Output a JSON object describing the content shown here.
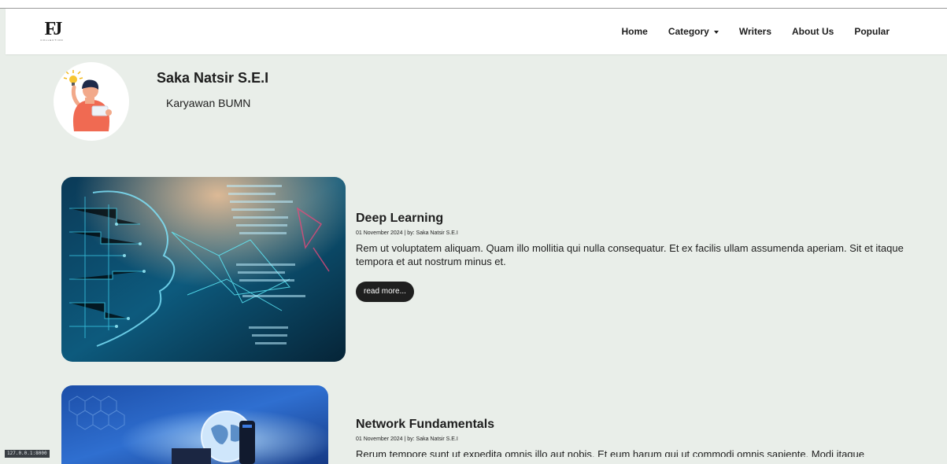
{
  "navbar": {
    "logo_text": "FJ",
    "logo_sub": "COLLECTION",
    "links": [
      {
        "label": "Home"
      },
      {
        "label": "Category",
        "dropdown": true
      },
      {
        "label": "Writers"
      },
      {
        "label": "About Us"
      },
      {
        "label": "Popular"
      }
    ]
  },
  "author": {
    "name": "Saka Natsir S.E.I",
    "job": "Karyawan BUMN",
    "avatar_icon": "person-idea-illustration"
  },
  "posts": [
    {
      "title": "Deep Learning",
      "meta": "01 November 2024 | by: Saka Natsir S.E.I",
      "excerpt": "Rem ut voluptatem aliquam. Quam illo mollitia qui nulla consequatur. Et ex facilis ullam assumenda aperiam. Sit et itaque tempora et aut nostrum minus et.",
      "button": "read more...",
      "image": "ai-head-code-illustration"
    },
    {
      "title": "Network Fundamentals",
      "meta": "01 November 2024 | by: Saka Natsir S.E.I",
      "excerpt": "Rerum tempore sunt ut expedita omnis illo aut nobis. Et eum harum qui ut commodi omnis sapiente. Modi itaque",
      "image": "network-globe-illustration"
    }
  ],
  "status_bar": {
    "url": "127.0.0.1:8000"
  },
  "colors": {
    "page_bg": "#e9eee9",
    "button_bg": "#1f1f1f",
    "accent_cyan": "#27d8f0"
  }
}
